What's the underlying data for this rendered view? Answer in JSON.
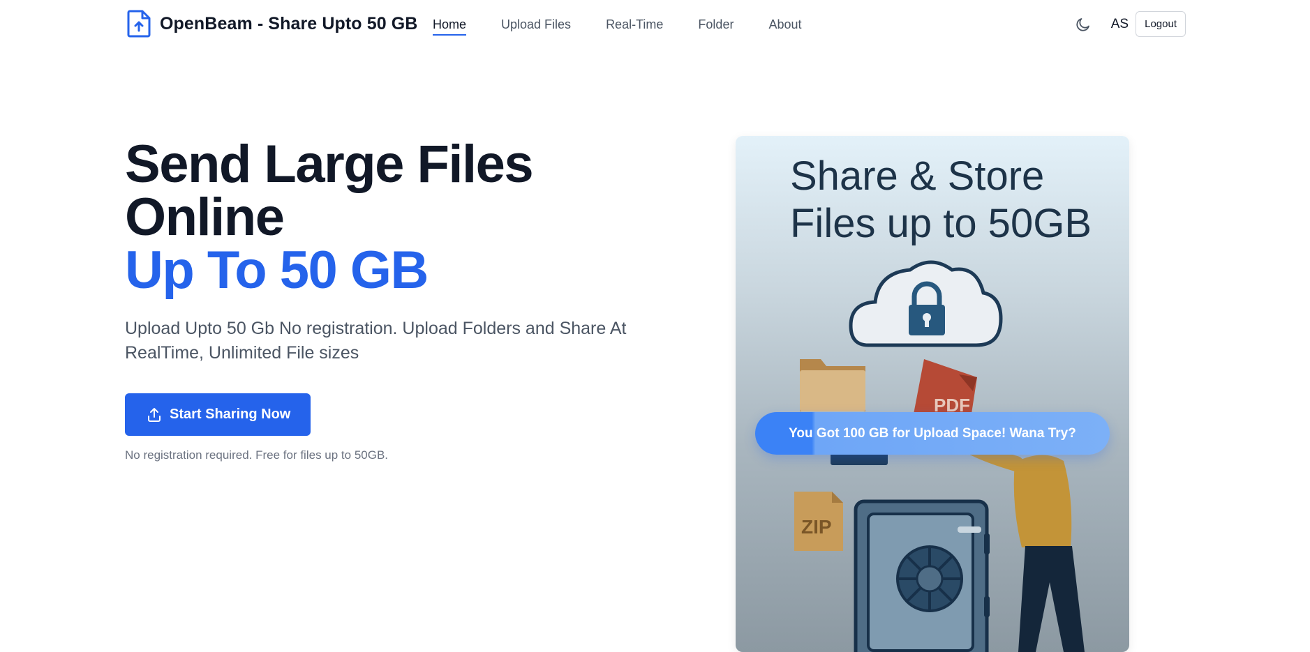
{
  "header": {
    "brand": "OpenBeam - Share Upto 50 GB",
    "nav": [
      "Home",
      "Upload Files",
      "Real-Time",
      "Folder",
      "About"
    ],
    "active_nav": "Home",
    "avatar_initials": "AS",
    "logout_label": "Logout",
    "icons": {
      "logo": "file-upload-icon",
      "theme_toggle": "moon-icon"
    }
  },
  "hero": {
    "title_line1": "Send Large Files",
    "title_line2": "Online",
    "title_accent": "Up To 50 GB",
    "subtitle": "Upload Upto 50 Gb No registration. Upload Folders and Share At RealTime, Unlimited File sizes",
    "cta_label": "Start Sharing Now",
    "cta_icon": "upload-icon",
    "note": "No registration required. Free for files up to 50GB."
  },
  "promo": {
    "title_line1": "Share & Store",
    "title_line2": "Files up to 50GB",
    "badge_zip": "ZIP",
    "badge_pdf": "PDF",
    "pill_label": "You Got 100 GB for Upload Space! Wana Try?"
  },
  "colors": {
    "accent": "#2563eb",
    "text_dark": "#111827",
    "text_muted": "#4b5563"
  }
}
